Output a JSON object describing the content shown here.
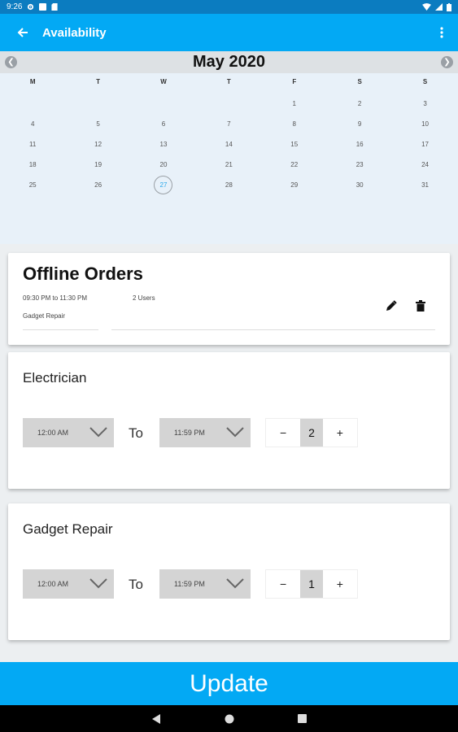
{
  "status": {
    "time": "9:26"
  },
  "appbar": {
    "title": "Availability"
  },
  "calendar": {
    "title": "May 2020",
    "weekdays": [
      "M",
      "T",
      "W",
      "T",
      "F",
      "S",
      "S"
    ],
    "weeks": [
      [
        "",
        "",
        "",
        "",
        "1",
        "2",
        "3"
      ],
      [
        "4",
        "5",
        "6",
        "7",
        "8",
        "9",
        "10"
      ],
      [
        "11",
        "12",
        "13",
        "14",
        "15",
        "16",
        "17"
      ],
      [
        "18",
        "19",
        "20",
        "21",
        "22",
        "23",
        "24"
      ],
      [
        "25",
        "26",
        "27",
        "28",
        "29",
        "30",
        "31"
      ]
    ],
    "selected_day": "27"
  },
  "order": {
    "title": "Offline Orders",
    "time_range": "09:30 PM to 11:30 PM",
    "users": "2 Users",
    "category": "Gadget Repair"
  },
  "skills": [
    {
      "name": "Electrician",
      "from": "12:00 AM",
      "to_label": "To",
      "to": "11:59 PM",
      "minus": "−",
      "count": "2",
      "plus": "+"
    },
    {
      "name": "Gadget Repair",
      "from": "12:00 AM",
      "to_label": "To",
      "to": "11:59 PM",
      "minus": "−",
      "count": "1",
      "plus": "+"
    }
  ],
  "update_label": "Update",
  "colors": {
    "accent": "#03a9f4",
    "status_bar": "#0b7cc0",
    "today_text": "#29a8ea"
  }
}
